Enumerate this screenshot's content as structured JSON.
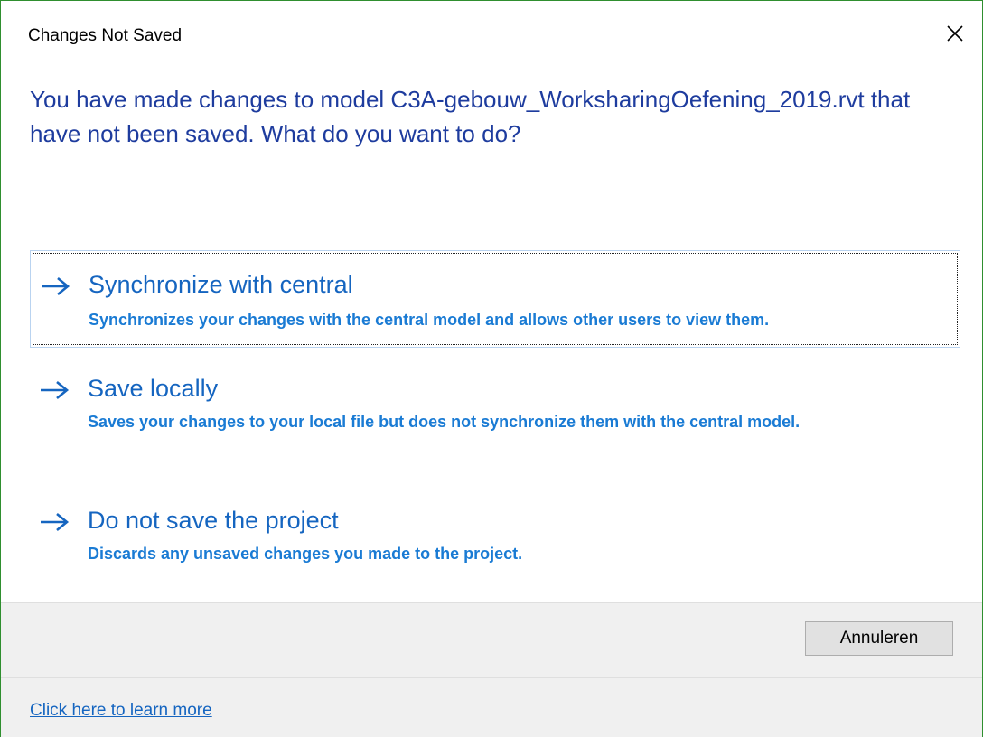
{
  "dialog": {
    "title": "Changes Not Saved",
    "close_icon": "close-icon",
    "main_instruction": "You have made changes to model C3A-gebouw_WorksharingOefening_2019.rvt that have not been saved. What do you want to do?"
  },
  "options": [
    {
      "icon": "arrow-right-icon",
      "label": "Synchronize with central",
      "description": "Synchronizes your changes with the central model and allows other users to view them.",
      "focused": true
    },
    {
      "icon": "arrow-right-icon",
      "label": "Save locally",
      "description": "Saves your changes to your local file but does not synchronize them with the central model.",
      "focused": false
    },
    {
      "icon": "arrow-right-icon",
      "label": "Do not save the project",
      "description": "Discards any unsaved changes you made to the project.",
      "focused": false
    }
  ],
  "footer": {
    "cancel_label": "Annuleren",
    "learn_more_label": "Click here to learn more"
  },
  "colors": {
    "instruction_text": "#1e3c9e",
    "option_label": "#1565c0",
    "option_description": "#1a7bd4",
    "window_border": "#2f8f2f",
    "footer_background": "#f0f0f0"
  }
}
